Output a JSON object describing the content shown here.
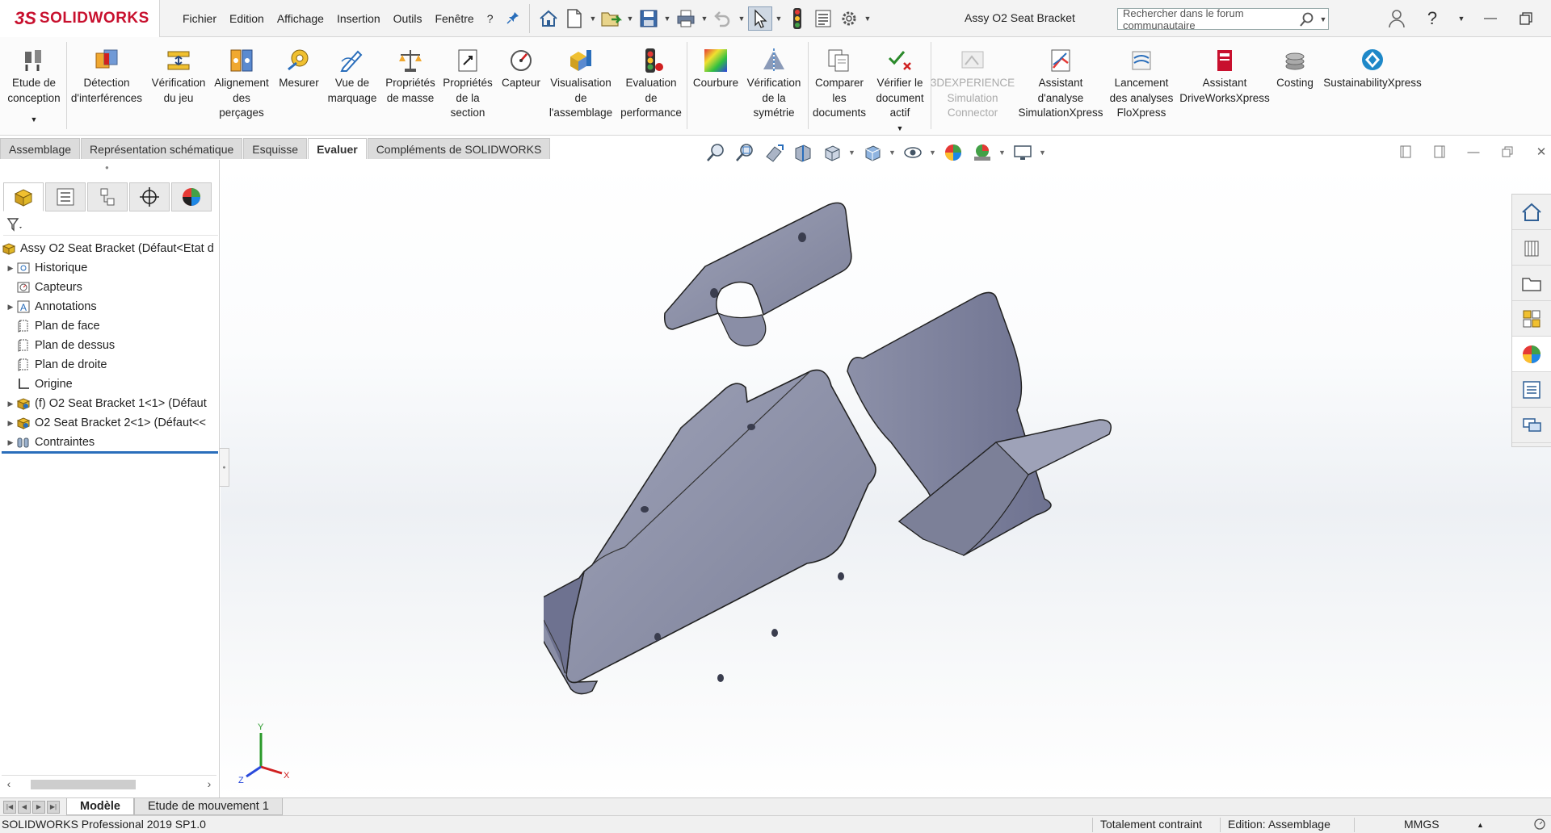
{
  "app": {
    "logo_ds": "3S",
    "logo_name": "SOLIDWORKS",
    "document_title": "Assy O2 Seat Bracket"
  },
  "menu": [
    "Fichier",
    "Edition",
    "Affichage",
    "Insertion",
    "Outils",
    "Fenêtre",
    "?"
  ],
  "search": {
    "placeholder": "Rechercher dans le forum communautaire"
  },
  "ribbon": [
    {
      "label": "Etude de\nconception",
      "icon": "design-study-icon"
    },
    {
      "label": "Détection\nd'interférences",
      "icon": "interference-detection-icon"
    },
    {
      "label": "Vérification\ndu jeu",
      "icon": "clearance-verification-icon"
    },
    {
      "label": "Alignement\ndes\nperçages",
      "icon": "hole-alignment-icon"
    },
    {
      "label": "Mesurer",
      "icon": "measure-icon"
    },
    {
      "label": "Vue de\nmarquage",
      "icon": "markup-view-icon"
    },
    {
      "label": "Propriétés\nde masse",
      "icon": "mass-properties-icon"
    },
    {
      "label": "Propriétés\nde la\nsection",
      "icon": "section-properties-icon"
    },
    {
      "label": "Capteur",
      "icon": "sensor-icon"
    },
    {
      "label": "Visualisation\nde\nl'assemblage",
      "icon": "assembly-visualization-icon"
    },
    {
      "label": "Evaluation\nde\nperformance",
      "icon": "performance-evaluation-icon"
    },
    {
      "label": "Courbure",
      "icon": "curvature-icon"
    },
    {
      "label": "Vérification\nde la\nsymétrie",
      "icon": "symmetry-check-icon"
    },
    {
      "label": "Comparer\nles\ndocuments",
      "icon": "compare-documents-icon"
    },
    {
      "label": "Vérifier le\ndocument\nactif",
      "icon": "check-active-document-icon"
    },
    {
      "label": "3DEXPERIENCE\nSimulation\nConnector",
      "icon": "3dexperience-icon",
      "disabled": true
    },
    {
      "label": "Assistant\nd'analyse\nSimulationXpress",
      "icon": "simulationxpress-icon"
    },
    {
      "label": "Lancement\ndes analyses\nFloXpress",
      "icon": "floxpress-icon"
    },
    {
      "label": "Assistant\nDriveWorksXpress",
      "icon": "driveworksxpress-icon"
    },
    {
      "label": "Costing",
      "icon": "costing-icon"
    },
    {
      "label": "SustainabilityXpress",
      "icon": "sustainabilityxpress-icon"
    }
  ],
  "tabs": [
    {
      "label": "Assemblage",
      "active": false
    },
    {
      "label": "Représentation schématique",
      "active": false
    },
    {
      "label": "Esquisse",
      "active": false
    },
    {
      "label": "Evaluer",
      "active": true
    },
    {
      "label": "Compléments de SOLIDWORKS",
      "active": false
    }
  ],
  "tree": [
    {
      "label": "Assy O2 Seat Bracket  (Défaut<Etat d",
      "icon": "assembly-icon",
      "arrow": false,
      "indent": 0
    },
    {
      "label": "Historique",
      "icon": "history-icon",
      "arrow": true,
      "indent": 1
    },
    {
      "label": "Capteurs",
      "icon": "sensors-icon",
      "arrow": false,
      "indent": 1
    },
    {
      "label": "Annotations",
      "icon": "annotations-icon",
      "arrow": true,
      "indent": 1
    },
    {
      "label": "Plan de face",
      "icon": "plane-icon",
      "arrow": false,
      "indent": 1
    },
    {
      "label": "Plan de dessus",
      "icon": "plane-icon",
      "arrow": false,
      "indent": 1
    },
    {
      "label": "Plan de droite",
      "icon": "plane-icon",
      "arrow": false,
      "indent": 1
    },
    {
      "label": "Origine",
      "icon": "origin-icon",
      "arrow": false,
      "indent": 1
    },
    {
      "label": "(f) O2 Seat Bracket 1<1> (Défaut",
      "icon": "part-icon",
      "arrow": true,
      "indent": 1
    },
    {
      "label": "O2 Seat Bracket 2<1> (Défaut<<",
      "icon": "part-icon",
      "arrow": true,
      "indent": 1
    },
    {
      "label": "Contraintes",
      "icon": "mates-icon",
      "arrow": true,
      "indent": 1
    }
  ],
  "bottom_tabs": [
    {
      "label": "Modèle",
      "active": true
    },
    {
      "label": "Etude de mouvement 1",
      "active": false
    }
  ],
  "status": {
    "version": "SOLIDWORKS Professional 2019 SP1.0",
    "constraint": "Totalement contraint",
    "edition": "Edition: Assemblage",
    "units": "MMGS"
  },
  "triad": {
    "x": "X",
    "y": "Y",
    "z": "Z"
  },
  "colors": {
    "brand": "#c8102e",
    "part": "#8a8ea6",
    "accent": "#2a6ebb"
  }
}
